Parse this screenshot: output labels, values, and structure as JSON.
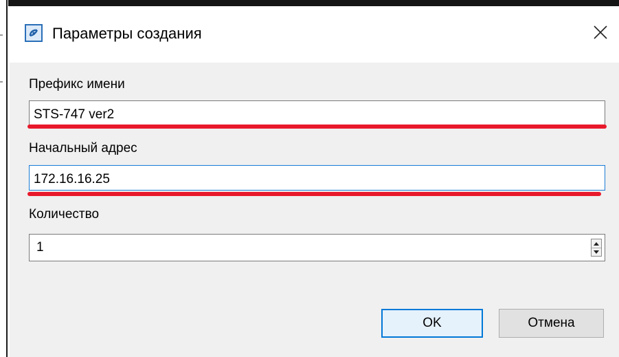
{
  "dialog": {
    "title": "Параметры создания",
    "close_symbol": "✕"
  },
  "fields": {
    "prefix_label": "Префикс имени",
    "prefix_value": "STS-747 ver2",
    "address_label": "Начальный адрес",
    "address_value": "172.16.16.25",
    "count_label": "Количество",
    "count_value": "1"
  },
  "buttons": {
    "ok": "OK",
    "cancel": "Отмена"
  },
  "colors": {
    "annotation_underline": "#e8192c",
    "focus_border": "#0078d7"
  }
}
